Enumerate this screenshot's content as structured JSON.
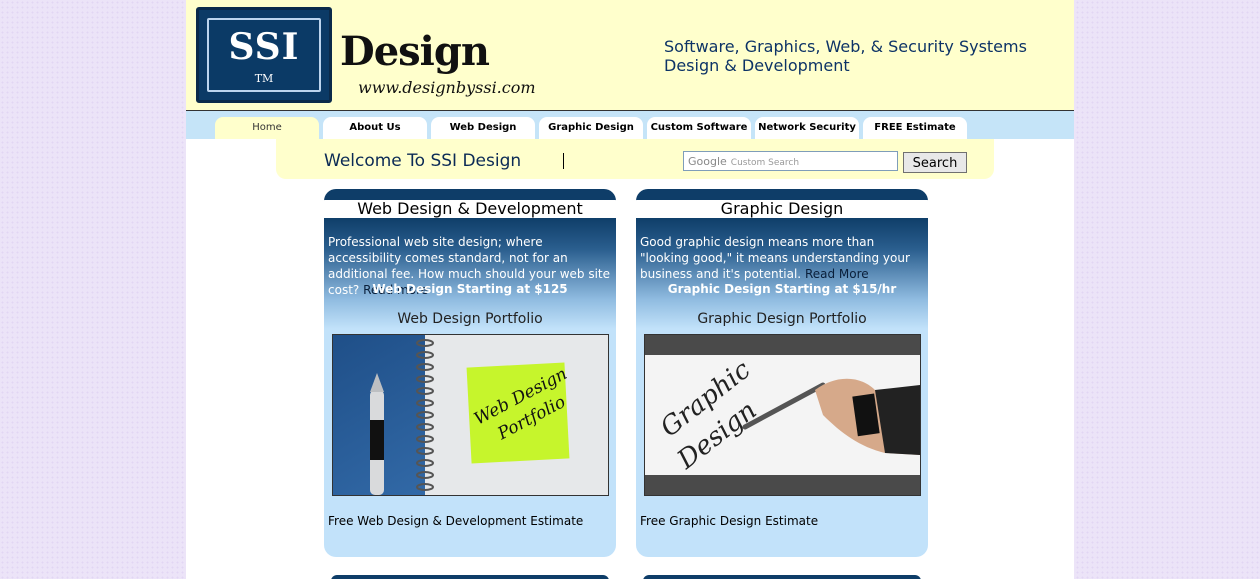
{
  "header": {
    "logo_ssi": "SSI",
    "logo_tm": "TM",
    "logo_design": "Design",
    "logo_url": "www.designbyssi.com",
    "tagline_line1": "Software, Graphics, Web, & Security Systems",
    "tagline_line2": "Design & Development"
  },
  "nav": {
    "tabs": [
      {
        "label": "Home",
        "active": true
      },
      {
        "label": "About Us",
        "active": false
      },
      {
        "label": "Web Design",
        "active": false
      },
      {
        "label": "Graphic Design",
        "active": false
      },
      {
        "label": "Custom Software",
        "active": false
      },
      {
        "label": "Network Security",
        "active": false
      },
      {
        "label": "FREE Estimate",
        "active": false
      }
    ]
  },
  "welcome": {
    "title": "Welcome To SSI Design"
  },
  "search": {
    "google_mark": "Google",
    "placeholder": "Custom Search",
    "button_label": "Search"
  },
  "panels": [
    {
      "title": "Web Design & Development",
      "description": "Professional web site design; where accessibility comes standard, not for an additional fee. How much should your web site cost?",
      "read_more": "Read more",
      "price": "Web Design Starting at $125",
      "portfolio": "Web Design Portfolio",
      "image_text": "Web Design Portfolio",
      "estimate": "Free Web Design & Development Estimate"
    },
    {
      "title": "Graphic Design",
      "description": "Good graphic design means more than \"looking good,\" it means understanding your business and it's potential.",
      "read_more": "Read More",
      "price": "Graphic Design Starting at $15/hr",
      "portfolio": "Graphic Design Portfolio",
      "image_text": "Graphic Design",
      "estimate": "Free Graphic Design Estimate"
    }
  ],
  "colors": {
    "page_background": "#ece4f8",
    "header_background": "#ffffcc",
    "nav_background": "#c5e4f8",
    "panel_dark": "#0e3d68",
    "panel_light": "#c2e2fa"
  }
}
